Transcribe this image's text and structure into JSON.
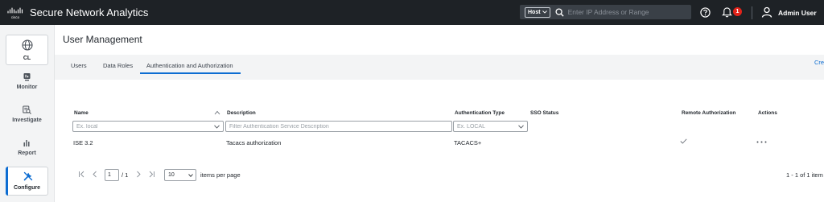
{
  "header": {
    "logo_text": "cisco",
    "app_title": "Secure Network Analytics",
    "host_selector": "Host",
    "search_placeholder": "Enter IP Address or Range",
    "notification_count": "1",
    "user_name": "Admin User"
  },
  "sidenav": {
    "items": [
      {
        "label": "CL",
        "icon": "globe-icon"
      },
      {
        "label": "Monitor",
        "icon": "monitor-icon"
      },
      {
        "label": "Investigate",
        "icon": "investigate-icon"
      },
      {
        "label": "Report",
        "icon": "report-icon"
      },
      {
        "label": "Configure",
        "icon": "wrench-icon",
        "active": true
      }
    ]
  },
  "page": {
    "title": "User Management",
    "create_link": "Cre"
  },
  "tabs": [
    {
      "label": "Users"
    },
    {
      "label": "Data Roles"
    },
    {
      "label": "Authentication and Authorization",
      "active": true
    }
  ],
  "table": {
    "columns": [
      "Name",
      "Description",
      "Authentication Type",
      "SSO Status",
      "Remote Authorization",
      "Actions"
    ],
    "filters": {
      "name_placeholder": "Ex. local",
      "description_placeholder": "Filter Authentication Service Description",
      "auth_type_placeholder": "Ex. LOCAL"
    },
    "rows": [
      {
        "name": "ISE 3.2",
        "description": "Tacacs authorization",
        "auth_type": "TACACS+",
        "sso_status": "",
        "remote_authorization": true
      }
    ]
  },
  "pagination": {
    "current_page": "1",
    "total_pages": "/ 1",
    "per_page": "10",
    "per_page_label": "items per page",
    "range": "1 - 1 of 1 item"
  },
  "colors": {
    "accent": "#0d6dd2",
    "topbar": "#1e2226",
    "badge": "#e2231a"
  }
}
